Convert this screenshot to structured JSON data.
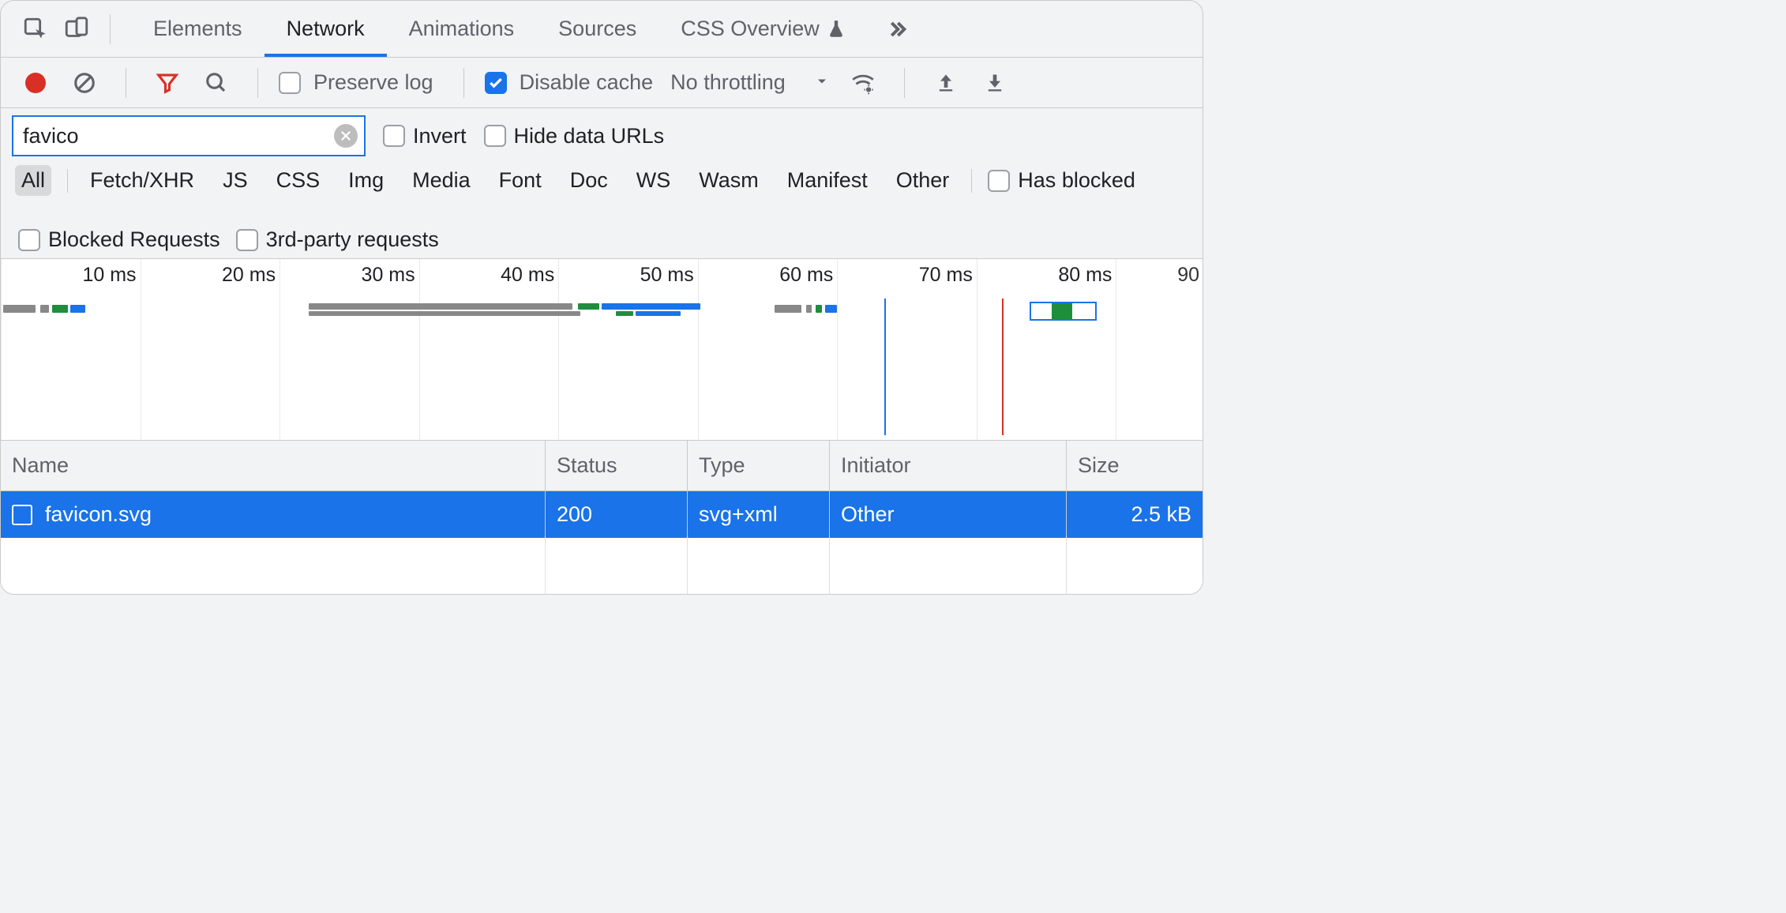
{
  "tabs": {
    "items": [
      "Elements",
      "Network",
      "Animations",
      "Sources",
      "CSS Overview"
    ],
    "active_index": 1
  },
  "toolbar": {
    "preserve_log": {
      "label": "Preserve log",
      "checked": false
    },
    "disable_cache": {
      "label": "Disable cache",
      "checked": true
    },
    "throttle": "No throttling"
  },
  "filter": {
    "value": "favico",
    "invert": {
      "label": "Invert",
      "checked": false
    },
    "hide_data_urls": {
      "label": "Hide data URLs",
      "checked": false
    }
  },
  "types": {
    "items": [
      "All",
      "Fetch/XHR",
      "JS",
      "CSS",
      "Img",
      "Media",
      "Font",
      "Doc",
      "WS",
      "Wasm",
      "Manifest",
      "Other"
    ],
    "active_index": 0,
    "has_blocked": {
      "label": "Has blocked",
      "checked": false
    },
    "blocked_requests": {
      "label": "Blocked Requests",
      "checked": false
    },
    "third_party": {
      "label": "3rd-party requests",
      "checked": false
    }
  },
  "timeline": {
    "ticks": [
      "10 ms",
      "20 ms",
      "30 ms",
      "40 ms",
      "50 ms",
      "60 ms",
      "70 ms",
      "80 ms",
      "90"
    ]
  },
  "table": {
    "columns": [
      "Name",
      "Status",
      "Type",
      "Initiator",
      "Size"
    ],
    "rows": [
      {
        "name": "favicon.svg",
        "status": "200",
        "type": "svg+xml",
        "initiator": "Other",
        "size": "2.5 kB"
      }
    ]
  }
}
